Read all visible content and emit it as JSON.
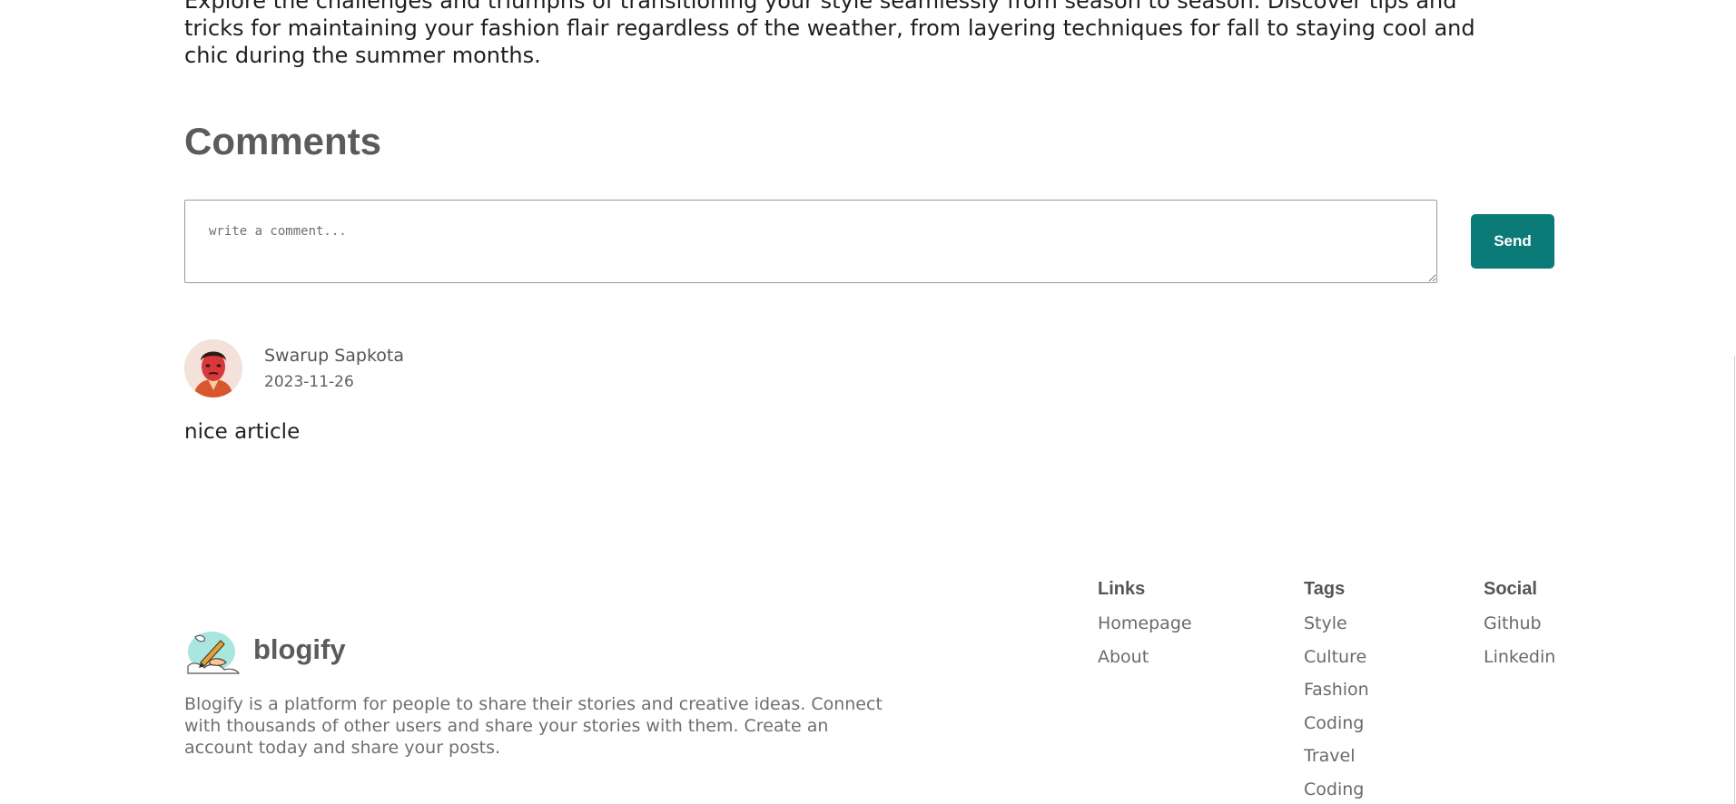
{
  "article": {
    "text": "Explore the challenges and triumphs of transitioning your style seamlessly from season to season. Discover tips and tricks for maintaining your fashion flair regardless of the weather, from layering techniques for fall to staying cool and chic during the summer months."
  },
  "comments": {
    "title": "Comments",
    "input_placeholder": "write a comment...",
    "send_label": "Send",
    "items": [
      {
        "author": "Swarup Sapkota",
        "date": "2023-11-26",
        "text": "nice article"
      }
    ]
  },
  "footer": {
    "brand": "blogify",
    "description": "Blogify is a platform for people to share their stories and creative ideas. Connect with thousands of other users and share your stories with them. Create an account today and share your posts.",
    "columns": [
      {
        "title": "Links",
        "items": [
          "Homepage",
          "About"
        ]
      },
      {
        "title": "Tags",
        "items": [
          "Style",
          "Culture",
          "Fashion",
          "Coding",
          "Travel",
          "Coding"
        ]
      },
      {
        "title": "Social",
        "items": [
          "Github",
          "Linkedin"
        ]
      }
    ]
  },
  "colors": {
    "accent": "#0b7b78",
    "heading": "#5b5b5b",
    "text": "#222222"
  }
}
